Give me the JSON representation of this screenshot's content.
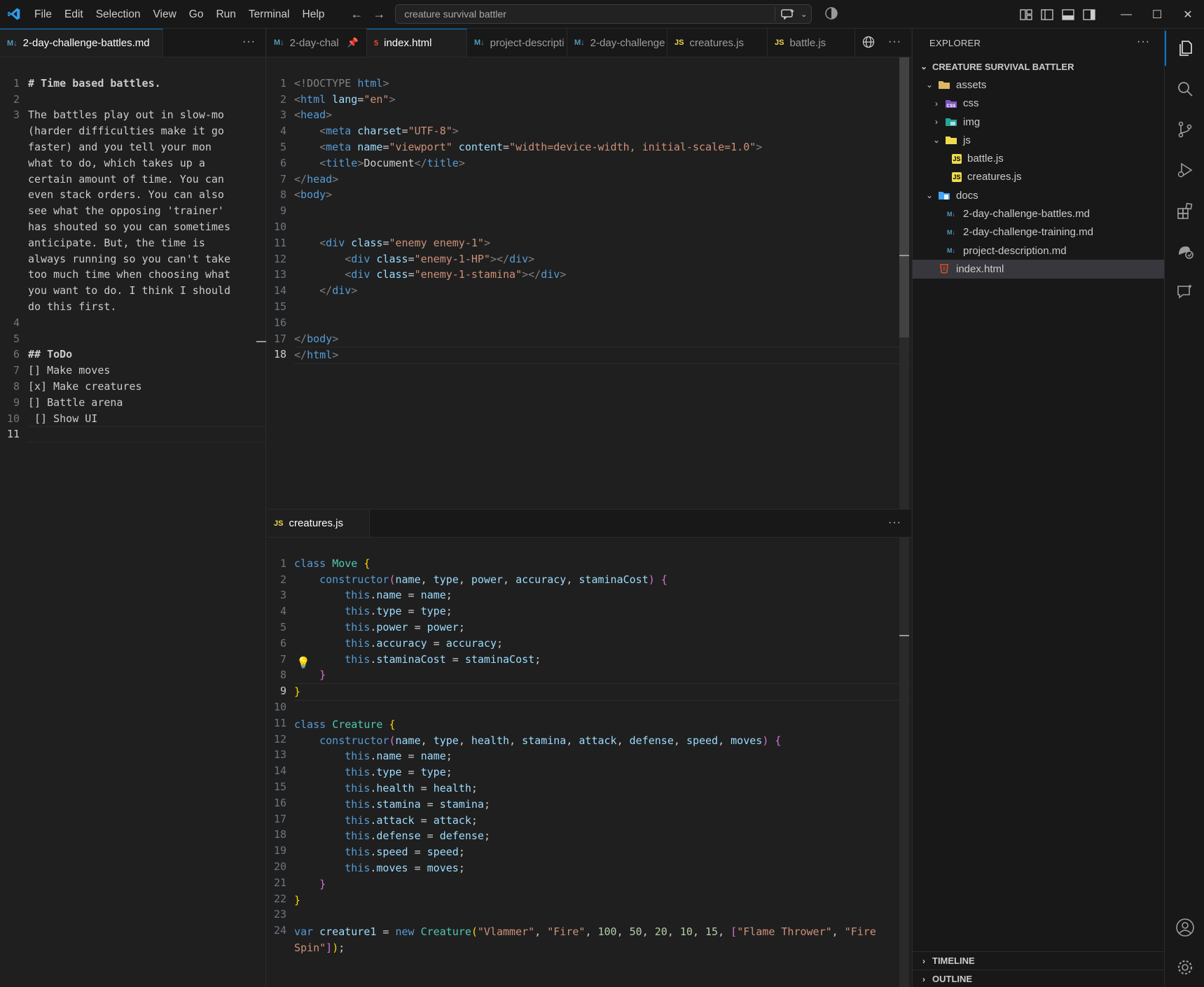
{
  "titlebar": {
    "menu": [
      "File",
      "Edit",
      "Selection",
      "View",
      "Go",
      "Run",
      "Terminal",
      "Help"
    ],
    "search_text": "creature survival battler"
  },
  "left_editor": {
    "tab_label": "2-day-challenge-battles.md",
    "line_numbers": [
      "1",
      "2",
      "3",
      "",
      "",
      "",
      "",
      "",
      "",
      "",
      "",
      "",
      "",
      "",
      "4",
      "5",
      "6",
      "7",
      "8",
      "9",
      "10",
      "11"
    ],
    "lines": [
      "# Time based battles.",
      "",
      "The battles play out in slow-mo",
      "(harder difficulties make it go",
      "faster) and you tell your mon",
      "what to do, which takes up a",
      "certain amount of time. You can",
      "even stack orders. You can also",
      "see what the opposing 'trainer'",
      "has shouted so you can sometimes",
      "anticipate. But, the time is",
      "always running so you can't take",
      "too much time when choosing what",
      "you want to do. I think I should",
      "do this first.",
      "",
      "",
      "## ToDo",
      "[] Make moves",
      "[x] Make creatures",
      "[] Battle arena",
      " [] Show UI",
      ""
    ]
  },
  "top_editor": {
    "tabs": [
      {
        "label": "2-day-chal",
        "icon": "md"
      },
      {
        "label": "index.html",
        "icon": "html"
      },
      {
        "label": "project-descripti",
        "icon": "md"
      },
      {
        "label": "2-day-challenge",
        "icon": "md"
      },
      {
        "label": "creatures.js",
        "icon": "js"
      },
      {
        "label": "battle.js",
        "icon": "js"
      }
    ],
    "line_numbers": [
      "1",
      "2",
      "3",
      "4",
      "5",
      "6",
      "7",
      "8",
      "9",
      "10",
      "11",
      "12",
      "13",
      "14",
      "15",
      "16",
      "17",
      "18"
    ],
    "html_lines": {
      "l1a": "<!DOCTYPE ",
      "l1b": "html",
      "l1c": ">",
      "l2a": "<",
      "l2b": "html",
      "l2c": " lang",
      "l2d": "=",
      "l2e": "\"en\"",
      "l2f": ">",
      "l3": "head",
      "l4a": "meta",
      "l4b": " charset",
      "l4c": "\"UTF-8\"",
      "l5a": "meta",
      "l5b": " name",
      "l5c": "\"viewport\"",
      "l5d": " content",
      "l5e": "\"width=device-width, initial-scale=1.0\"",
      "l6a": "title",
      "l6b": "Document",
      "l6c": "title",
      "l7": "head",
      "l8": "body",
      "l11a": "div",
      "l11b": " class",
      "l11c": "\"enemy enemy-1\"",
      "l12a": "div",
      "l12b": " class",
      "l12c": "\"enemy-1-HP\"",
      "l12d": "div",
      "l13a": "div",
      "l13b": " class",
      "l13c": "\"enemy-1-stamina\"",
      "l13d": "div",
      "l14": "div",
      "l17": "body",
      "l18": "html"
    }
  },
  "bottom_editor": {
    "tab_label": "creatures.js",
    "line_numbers": [
      "1",
      "2",
      "3",
      "4",
      "5",
      "6",
      "7",
      "8",
      "9",
      "10",
      "11",
      "12",
      "13",
      "14",
      "15",
      "16",
      "17",
      "18",
      "19",
      "20",
      "21",
      "22",
      "23",
      "24",
      ""
    ],
    "js": {
      "move_params": [
        "name",
        "type",
        "power",
        "accuracy",
        "staminaCost"
      ],
      "creature_params": [
        "name",
        "type",
        "health",
        "stamina",
        "attack",
        "defense",
        "speed",
        "moves"
      ],
      "creature1": {
        "name": "\"Vlammer\"",
        "type": "\"Fire\"",
        "n1": "100",
        "n2": "50",
        "n3": "20",
        "n4": "10",
        "n5": "15",
        "m1": "\"Flame Thrower\"",
        "m2a": "\"Fire",
        "m2b": "Spin\""
      }
    }
  },
  "explorer": {
    "title": "EXPLORER",
    "root": "CREATURE SURVIVAL BATTLER",
    "items": [
      {
        "label": "assets",
        "depth": 1,
        "kind": "folder-open"
      },
      {
        "label": "css",
        "depth": 2,
        "kind": "folder-css"
      },
      {
        "label": "img",
        "depth": 2,
        "kind": "folder-img"
      },
      {
        "label": "js",
        "depth": 2,
        "kind": "folder-js"
      },
      {
        "label": "battle.js",
        "depth": 3,
        "kind": "js"
      },
      {
        "label": "creatures.js",
        "depth": 3,
        "kind": "js"
      },
      {
        "label": "docs",
        "depth": 1,
        "kind": "folder-docs"
      },
      {
        "label": "2-day-challenge-battles.md",
        "depth": 2,
        "kind": "md"
      },
      {
        "label": "2-day-challenge-training.md",
        "depth": 2,
        "kind": "md"
      },
      {
        "label": "project-description.md",
        "depth": 2,
        "kind": "md"
      },
      {
        "label": "index.html",
        "depth": 1,
        "kind": "html"
      }
    ],
    "timeline": "TIMELINE",
    "outline": "OUTLINE"
  },
  "colors": {
    "accent": "#0078d4",
    "html_icon": "#e44d26",
    "js_icon": "#f0db4f",
    "md_icon": "#519aba"
  }
}
